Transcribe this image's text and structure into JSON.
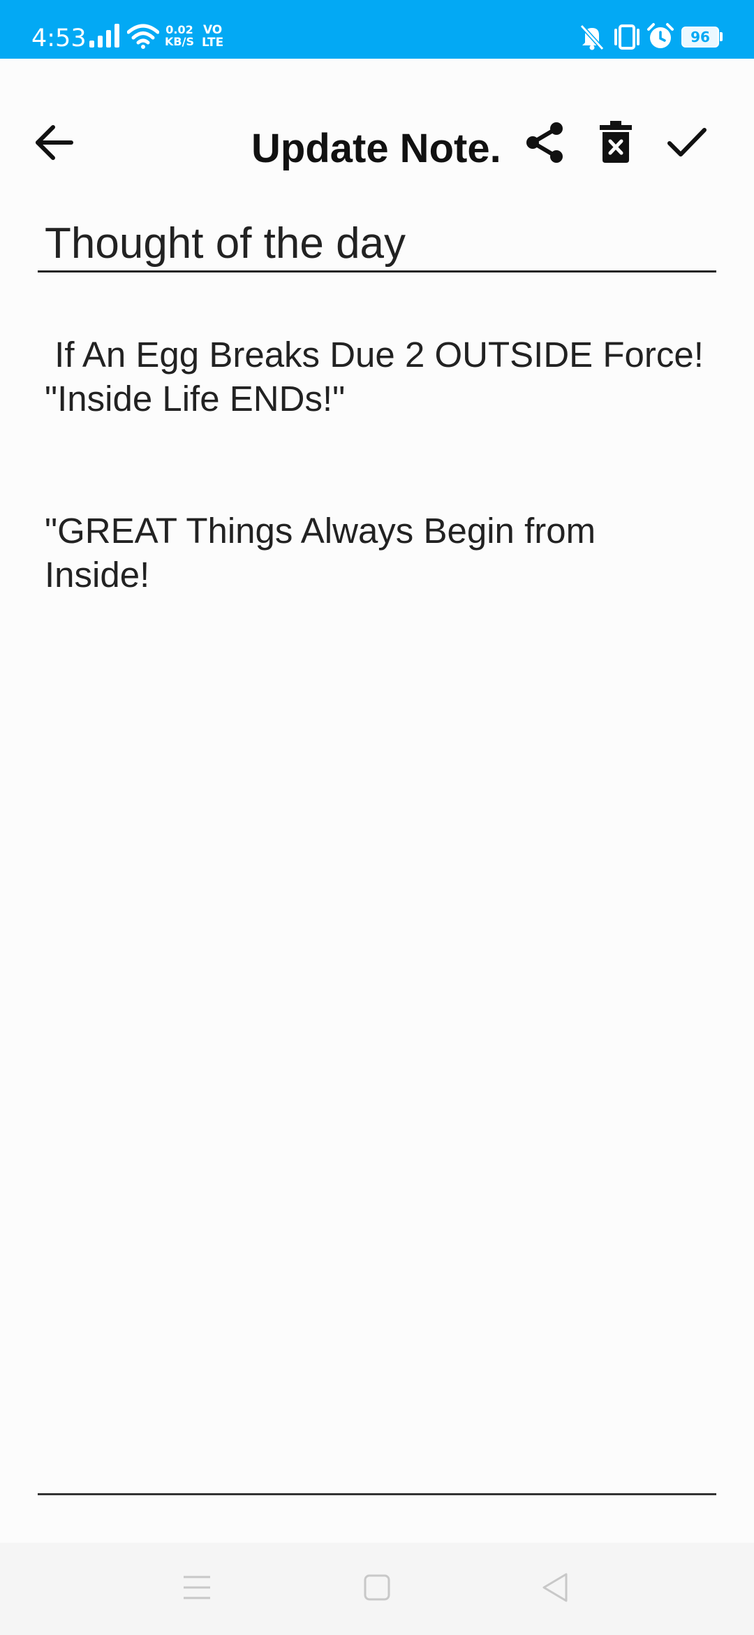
{
  "status_bar": {
    "time": "4:53",
    "net_speed_value": "0.02",
    "net_speed_unit": "KB/S",
    "volte_top": "VO",
    "volte_bottom": "LTE",
    "battery": "96",
    "icons": [
      "signal-icon",
      "wifi-icon",
      "mute-icon",
      "vibrate-icon",
      "alarm-icon",
      "battery-icon"
    ],
    "bg_color": "#03a9f4"
  },
  "app_bar": {
    "title": "Update Note.",
    "icons": [
      "back-arrow-icon",
      "share-icon",
      "delete-icon",
      "check-icon"
    ]
  },
  "note": {
    "title": "Thought of the day",
    "body": " If An Egg Breaks Due 2 OUTSIDE Force! \"Inside Life ENDs!\"\n\n\n\"GREAT Things Always Begin from Inside!"
  },
  "nav_bar": {
    "icons": [
      "menu-icon",
      "home-icon",
      "back-triangle-icon"
    ]
  }
}
